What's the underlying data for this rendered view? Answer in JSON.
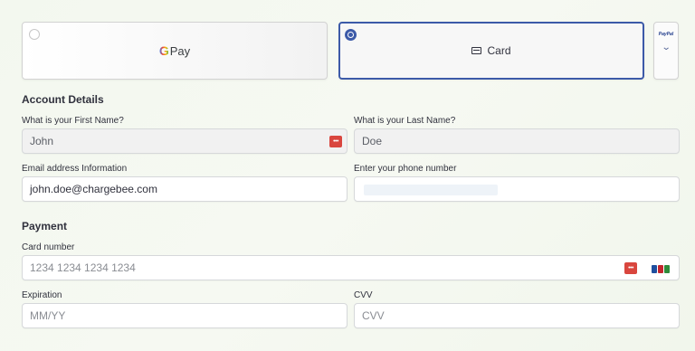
{
  "payment_methods": {
    "gpay": {
      "g": "G",
      "label": "Pay",
      "selected": false
    },
    "card": {
      "label": "Card",
      "selected": true
    },
    "more": {
      "logo_text": "PayPal",
      "chevron": "chevron-down-icon"
    }
  },
  "account": {
    "title": "Account Details",
    "first_name": {
      "label": "What is your First Name?",
      "value": "John"
    },
    "last_name": {
      "label": "What is your Last Name?",
      "value": "Doe"
    },
    "email": {
      "label": "Email address Information",
      "value": "john.doe@chargebee.com"
    },
    "phone": {
      "label": "Enter your phone number",
      "value": ""
    }
  },
  "payment": {
    "title": "Payment",
    "card_number": {
      "label": "Card number",
      "placeholder": "1234 1234 1234 1234"
    },
    "expiration": {
      "label": "Expiration",
      "placeholder": "MM/YY"
    },
    "cvv": {
      "label": "CVV",
      "placeholder": "CVV"
    },
    "badge_text": "•••"
  },
  "colors": {
    "accent": "#3c5aa8",
    "badge": "#d9463e",
    "jcb": [
      "#1f4f9e",
      "#c3262e",
      "#2e8b3a"
    ]
  }
}
